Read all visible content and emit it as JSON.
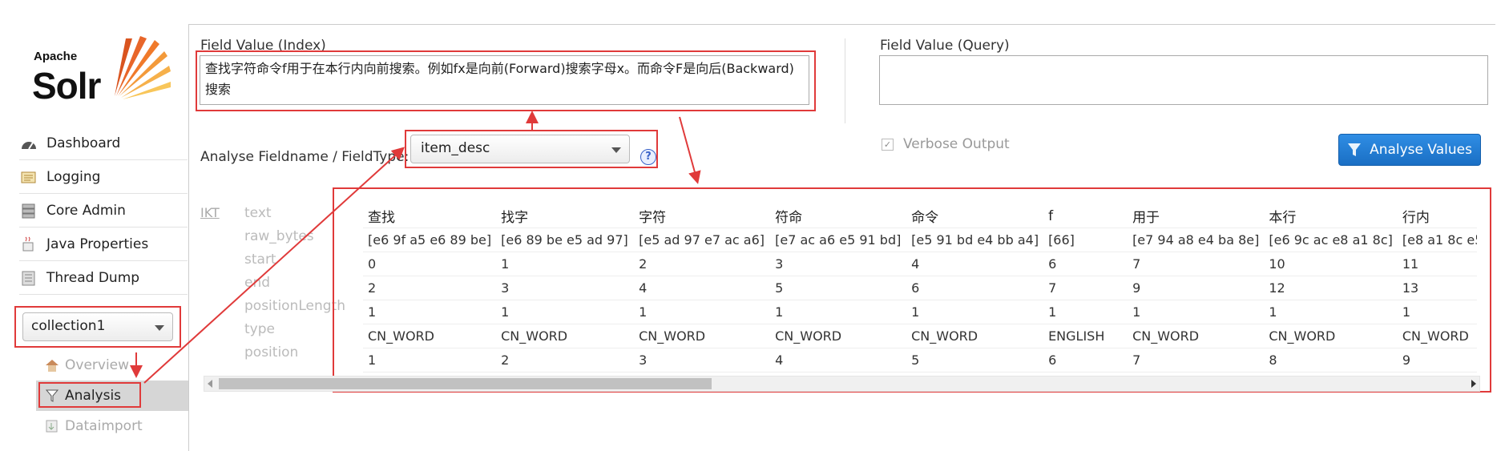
{
  "logo": {
    "line1": "Apache",
    "line2": "Solr"
  },
  "nav": [
    {
      "label": "Dashboard",
      "icon": "dashboard-icon"
    },
    {
      "label": "Logging",
      "icon": "logging-icon"
    },
    {
      "label": "Core Admin",
      "icon": "core-admin-icon"
    },
    {
      "label": "Java Properties",
      "icon": "java-icon"
    },
    {
      "label": "Thread Dump",
      "icon": "thread-dump-icon"
    }
  ],
  "core_selector": {
    "value": "collection1"
  },
  "core_nav": [
    {
      "label": "Overview",
      "icon": "home-icon"
    },
    {
      "label": "Analysis",
      "icon": "filter-icon"
    },
    {
      "label": "Dataimport",
      "icon": "dataimport-icon"
    }
  ],
  "analysis": {
    "index_label": "Field Value (Index)",
    "index_value": "查找字符命令f用于在本行内向前搜索。例如fx是向前(Forward)搜索字母x。而命令F是向后(Backward)搜索",
    "query_label": "Field Value (Query)",
    "query_value": "",
    "fieldname_label": "Analyse Fieldname / FieldType:",
    "fieldtype_value": "item_desc",
    "help": "?",
    "verbose_label": "Verbose Output",
    "verbose_checked": true,
    "button_label": "Analyse Values"
  },
  "tokenizer": "IKT",
  "row_labels": [
    "text",
    "raw_bytes",
    "start",
    "end",
    "positionLength",
    "type",
    "position"
  ],
  "tokens": [
    {
      "text": "查找",
      "raw_bytes": "[e6 9f a5 e6 89 be]",
      "start": "0",
      "end": "2",
      "positionLength": "1",
      "type": "CN_WORD",
      "position": "1"
    },
    {
      "text": "找字",
      "raw_bytes": "[e6 89 be e5 ad 97]",
      "start": "1",
      "end": "3",
      "positionLength": "1",
      "type": "CN_WORD",
      "position": "2"
    },
    {
      "text": "字符",
      "raw_bytes": "[e5 ad 97 e7 ac a6]",
      "start": "2",
      "end": "4",
      "positionLength": "1",
      "type": "CN_WORD",
      "position": "3"
    },
    {
      "text": "符命",
      "raw_bytes": "[e7 ac a6 e5 91 bd]",
      "start": "3",
      "end": "5",
      "positionLength": "1",
      "type": "CN_WORD",
      "position": "4"
    },
    {
      "text": "命令",
      "raw_bytes": "[e5 91 bd e4 bb a4]",
      "start": "4",
      "end": "6",
      "positionLength": "1",
      "type": "CN_WORD",
      "position": "5"
    },
    {
      "text": "f",
      "raw_bytes": "[66]",
      "start": "6",
      "end": "7",
      "positionLength": "1",
      "type": "ENGLISH",
      "position": "6"
    },
    {
      "text": "用于",
      "raw_bytes": "[e7 94 a8 e4 ba 8e]",
      "start": "7",
      "end": "9",
      "positionLength": "1",
      "type": "CN_WORD",
      "position": "7"
    },
    {
      "text": "本行",
      "raw_bytes": "[e6 9c ac e8 a1 8c]",
      "start": "10",
      "end": "12",
      "positionLength": "1",
      "type": "CN_WORD",
      "position": "8"
    },
    {
      "text": "行内",
      "raw_bytes": "[e8 a1 8c e5 8",
      "start": "11",
      "end": "13",
      "positionLength": "1",
      "type": "CN_WORD",
      "position": "9"
    }
  ]
}
